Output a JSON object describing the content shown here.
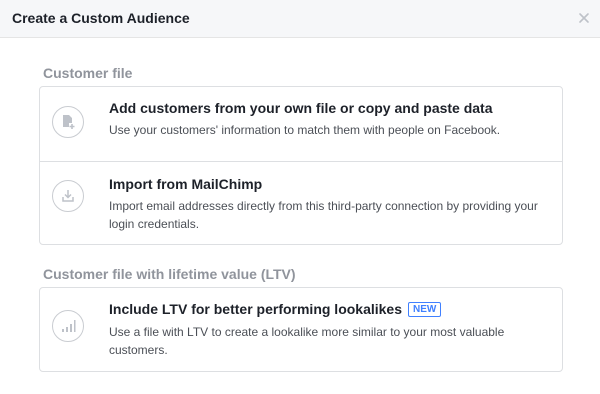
{
  "dialog": {
    "title": "Create a Custom Audience",
    "close_icon": "close-icon"
  },
  "sections": [
    {
      "title": "Customer file",
      "options": [
        {
          "icon": "add-file-icon",
          "title": "Add customers from your own file or copy and paste data",
          "description": "Use your customers' information to match them with people on Facebook."
        },
        {
          "icon": "import-download-icon",
          "title": "Import from MailChimp",
          "description": "Import email addresses directly from this third-party connection by providing your login credentials."
        }
      ]
    },
    {
      "title": "Customer file with lifetime value (LTV)",
      "options": [
        {
          "icon": "bar-chart-icon",
          "title": "Include LTV for better performing lookalikes",
          "badge": "NEW",
          "description": "Use a file with LTV to create a lookalike more similar to your most valuable customers."
        }
      ]
    }
  ],
  "colors": {
    "accent": "#4080ff",
    "section_title": "#90949c",
    "border": "#dddfe2",
    "header_bg": "#f6f7f9"
  }
}
